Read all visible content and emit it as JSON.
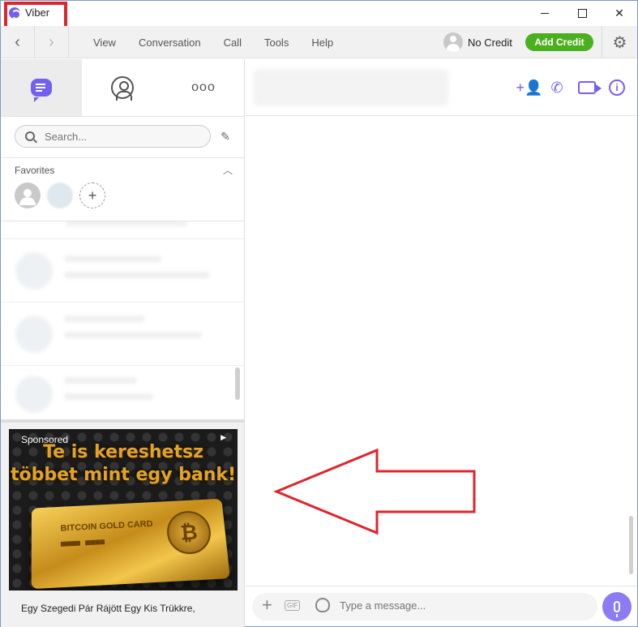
{
  "window": {
    "title": "Viber"
  },
  "menubar": {
    "back_icon": "chevron-left-icon",
    "forward_icon": "chevron-right-icon",
    "items": [
      "View",
      "Conversation",
      "Call",
      "Tools",
      "Help"
    ],
    "credit_label": "No Credit",
    "add_credit_label": "Add Credit",
    "add_credit_color": "#4caf20",
    "settings_icon": "gear-icon"
  },
  "sidebar": {
    "tabs": [
      "chats-icon",
      "contacts-icon",
      "more-icon"
    ],
    "more_glyph": "ooo",
    "search": {
      "placeholder": "Search..."
    },
    "favorites": {
      "title": "Favorites",
      "add_glyph": "+"
    },
    "ad": {
      "sponsored_label": "Sponsored",
      "headline_line1": "Te is kereshetsz",
      "headline_line2": "többet mint egy bank!",
      "card_label": "BITCOIN GOLD CARD",
      "caption": "Egy Szegedi Pár Rájött Egy Kis Trükkre,"
    }
  },
  "conversation": {
    "header_icons": [
      "add-participant-icon",
      "voice-call-icon",
      "video-call-icon",
      "info-icon"
    ],
    "composer": {
      "placeholder": "Type a message...",
      "gif_label": "GIF"
    }
  },
  "colors": {
    "accent": "#7360f2",
    "annotation": "#e0242c"
  }
}
